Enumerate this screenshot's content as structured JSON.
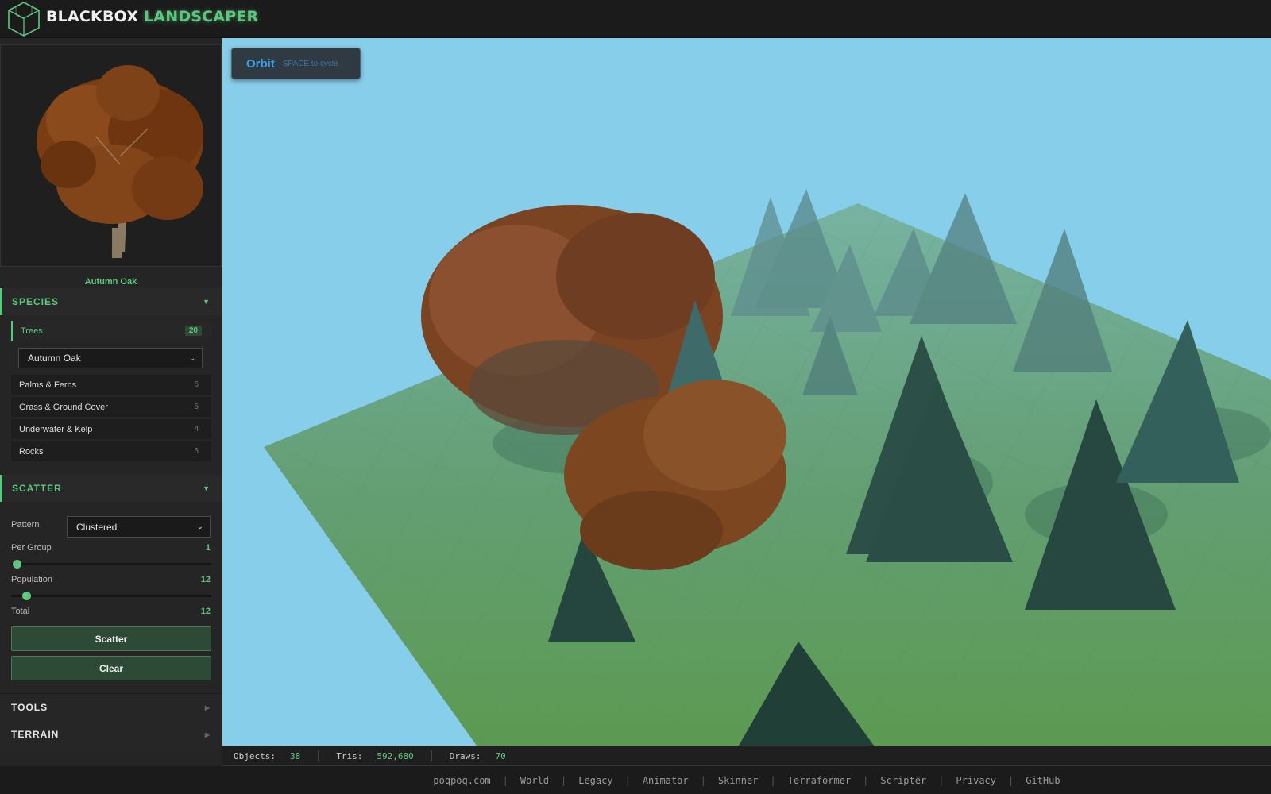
{
  "app": {
    "title_part1": "BLACKBOX",
    "title_part2": "LANDSCAPER"
  },
  "preview": {
    "name": "Autumn Oak"
  },
  "species": {
    "header": "SPECIES",
    "categories": [
      {
        "label": "Trees",
        "count": "20",
        "active": true
      },
      {
        "label": "Palms & Ferns",
        "count": "6"
      },
      {
        "label": "Grass & Ground Cover",
        "count": "5"
      },
      {
        "label": "Underwater & Kelp",
        "count": "4"
      },
      {
        "label": "Rocks",
        "count": "5"
      }
    ],
    "selected_species": "Autumn Oak"
  },
  "scatter": {
    "header": "SCATTER",
    "pattern_label": "Pattern",
    "pattern_value": "Clustered",
    "per_group_label": "Per Group",
    "per_group_value": "1",
    "per_group_fraction": 0.0,
    "population_label": "Population",
    "population_value": "12",
    "population_fraction": 0.05,
    "total_label": "Total",
    "total_value": "12",
    "scatter_button": "Scatter",
    "clear_button": "Clear"
  },
  "collapsed_sections": {
    "tools": "TOOLS",
    "terrain": "TERRAIN"
  },
  "viewport": {
    "mode": "Orbit",
    "mode_hint": "SPACE to cycle"
  },
  "stats": {
    "objects_label": "Objects:",
    "objects_value": "38",
    "tris_label": "Tris:",
    "tris_value": "592,680",
    "draws_label": "Draws:",
    "draws_value": "70"
  },
  "footer": {
    "links": [
      "poqpoq.com",
      "World",
      "Legacy",
      "Animator",
      "Skinner",
      "Terraformer",
      "Scripter",
      "Privacy",
      "GitHub"
    ],
    "separator": "|"
  },
  "colors": {
    "accent": "#5ec77f",
    "sky": "#87ceeb",
    "ground": "#5f9a68",
    "autumn": "#8a4a1e",
    "evergreen": "#2f5a52"
  }
}
